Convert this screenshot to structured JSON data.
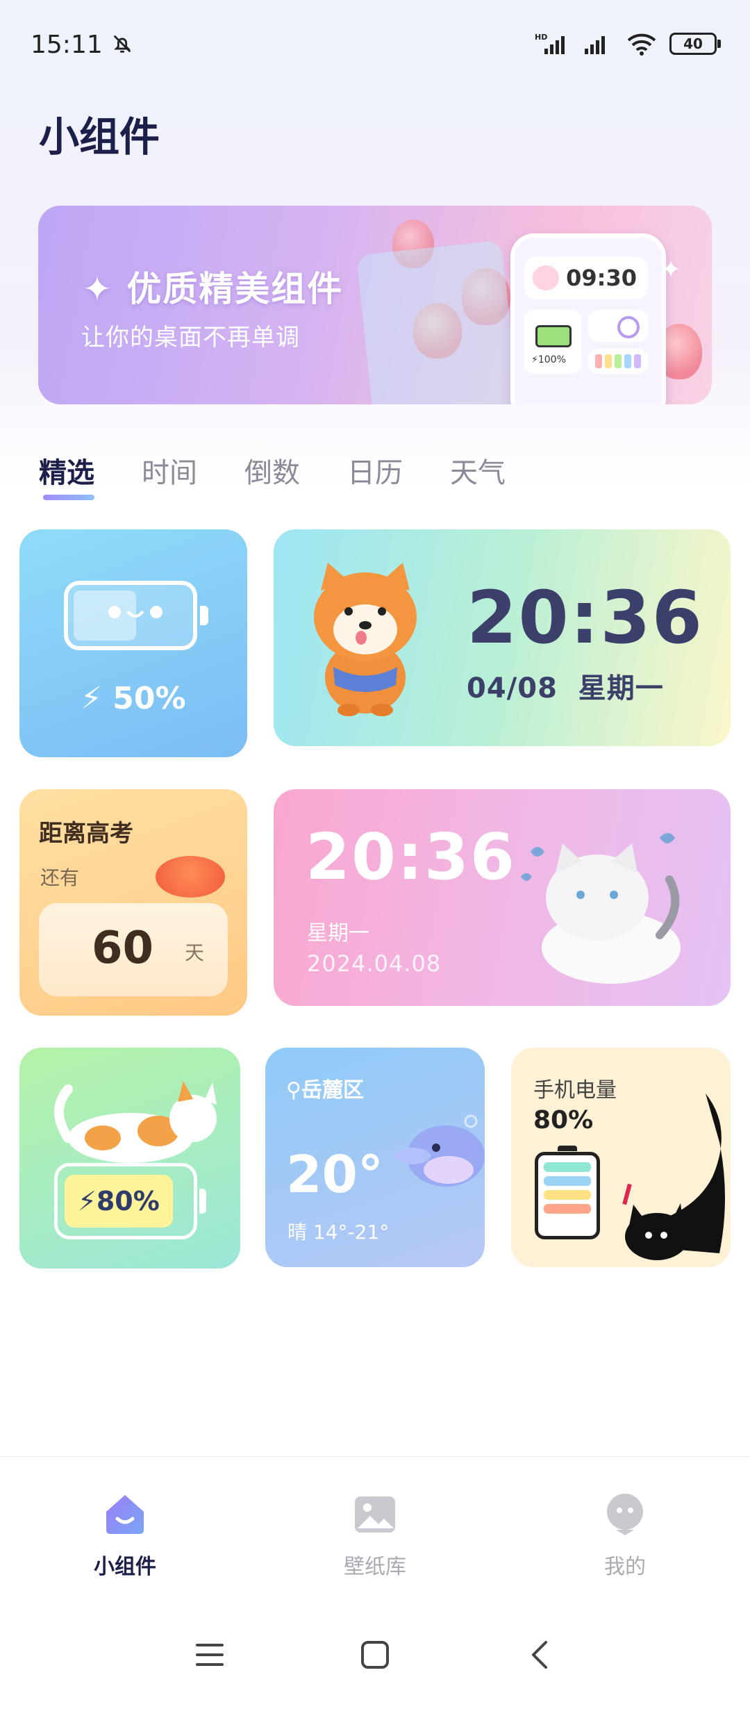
{
  "status": {
    "time": "15:11",
    "network_hd": "HD",
    "battery": "40"
  },
  "header": {
    "title": "小组件"
  },
  "banner": {
    "title": "优质精美组件",
    "subtitle": "让你的桌面不再单调",
    "mock_time": "09:30",
    "mock_battery": "100%"
  },
  "tabs": [
    "精选",
    "时间",
    "倒数",
    "日历",
    "天气"
  ],
  "widgets": {
    "battery_small": {
      "percent": "50%"
    },
    "clock_dog": {
      "time": "20:36",
      "date": "04/08",
      "weekday": "星期一"
    },
    "countdown": {
      "title": "距离高考",
      "sub": "还有",
      "days": "60",
      "unit": "天"
    },
    "clock_cat": {
      "time": "20:36",
      "weekday": "星期一",
      "date": "2024.04.08"
    },
    "battery_cat": {
      "percent": "80%"
    },
    "weather": {
      "location": "岳麓区",
      "temp": "20°",
      "condition": "晴 14°-21°"
    },
    "phone_battery": {
      "title": "手机电量",
      "percent": "80%"
    }
  },
  "nav": {
    "items": [
      {
        "label": "小组件",
        "icon": "widget-icon"
      },
      {
        "label": "壁纸库",
        "icon": "gallery-icon"
      },
      {
        "label": "我的",
        "icon": "profile-icon"
      }
    ]
  },
  "colors": {
    "primary": "#1b1f4a",
    "accent": "#a28cf5"
  }
}
